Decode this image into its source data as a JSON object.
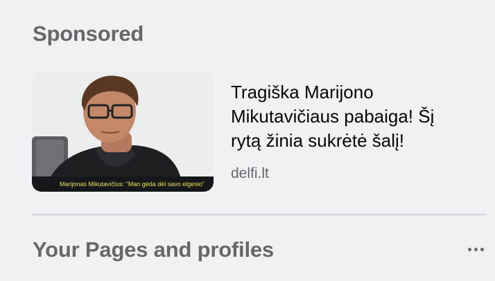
{
  "sponsored": {
    "heading": "Sponsored",
    "ad": {
      "title": "Tragiška Marijono Mikutavičiaus pabaiga! Šį rytą žinia sukrėtė šalį!",
      "domain": "delfi.lt",
      "image_caption": "Marijonas Mikutavičius: \"Man gėda dėl savo elgesio\""
    }
  },
  "pages": {
    "heading": "Your Pages and profiles",
    "more_icon": "more-horizontal-icon"
  },
  "colors": {
    "background": "#f0f1f5",
    "heading": "#65676b",
    "title": "#050505",
    "caption_text": "#e8e24a"
  }
}
